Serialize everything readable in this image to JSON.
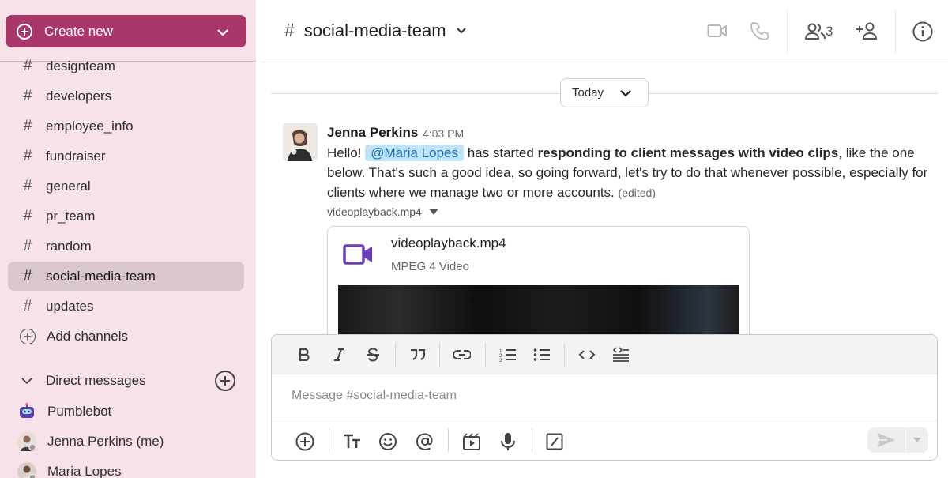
{
  "sidebar": {
    "create_label": "Create new",
    "channels": [
      {
        "name": "designteam"
      },
      {
        "name": "developers"
      },
      {
        "name": "employee_info"
      },
      {
        "name": "fundraiser"
      },
      {
        "name": "general"
      },
      {
        "name": "pr_team"
      },
      {
        "name": "random"
      },
      {
        "name": "social-media-team",
        "active": true
      },
      {
        "name": "updates"
      }
    ],
    "add_channels_label": "Add channels",
    "dm_header": "Direct messages",
    "dms": [
      {
        "name": "Pumblebot"
      },
      {
        "name": "Jenna Perkins (me)"
      },
      {
        "name": "Maria Lopes"
      }
    ],
    "hash": "#"
  },
  "header": {
    "channel_name": "social-media-team",
    "hash": "#",
    "member_count": "3",
    "icons": [
      "video-icon",
      "phone-icon",
      "members-icon",
      "add-member-icon",
      "info-icon"
    ]
  },
  "date_divider": {
    "label": "Today"
  },
  "message": {
    "author": "Jenna Perkins",
    "time": "4:03 PM",
    "text_1": "Hello! ",
    "mention": "@Maria Lopes",
    "text_2": " has started ",
    "text_bold": "responding to client messages with video clips",
    "text_3": ", like the one below. That's such a good idea, so going forward, let's try to do that whenever possible, especially for clients where we manage two or more accounts.",
    "edited": "(edited)",
    "attachment_label": "videoplayback.mp4",
    "attachment": {
      "file_name": "videoplayback.mp4",
      "file_type": "MPEG 4 Video"
    }
  },
  "composer": {
    "placeholder": "Message #social-media-team",
    "toolbar": [
      "bold-icon",
      "italic-icon",
      "strikethrough-icon",
      "quote-icon",
      "link-icon",
      "ordered-list-icon",
      "bullet-list-icon",
      "code-icon",
      "code-block-icon"
    ],
    "bottom": [
      "attach-icon",
      "text-format-icon",
      "emoji-icon",
      "mention-icon",
      "video-clip-icon",
      "microphone-icon",
      "slash-command-icon",
      "send-icon"
    ]
  },
  "colors": {
    "sidebar_bg": "#f7e2ea",
    "accent": "#a8376a",
    "mention_bg": "#bfe3f7",
    "video_icon": "#6b3fb5"
  }
}
